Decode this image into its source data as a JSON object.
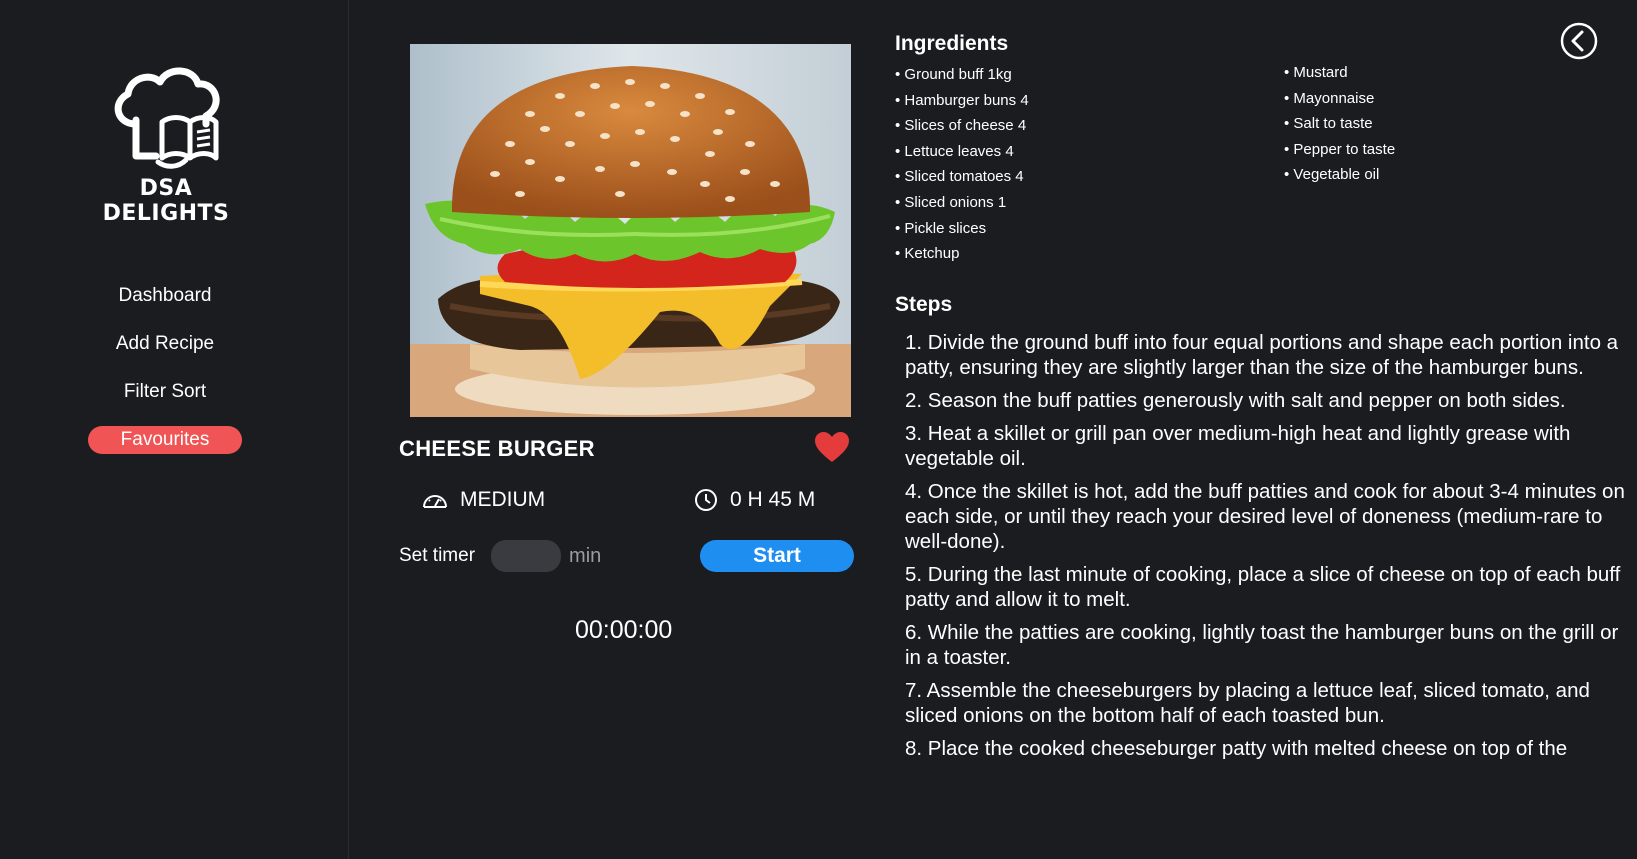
{
  "brand": {
    "name": "DSA DELIGHTS"
  },
  "nav": [
    {
      "label": "Dashboard",
      "active": false
    },
    {
      "label": "Add Recipe",
      "active": false
    },
    {
      "label": "Filter Sort",
      "active": false
    },
    {
      "label": "Favourites",
      "active": true
    }
  ],
  "recipe": {
    "title": "CHEESE BURGER",
    "difficulty": "MEDIUM",
    "time": "0 H 45 M",
    "favourite": true
  },
  "timer": {
    "label": "Set timer",
    "value": "",
    "unit": "min",
    "start_label": "Start",
    "countdown": "00:00:00"
  },
  "ingredients": {
    "title": "Ingredients",
    "column1": [
      "Ground buff 1kg",
      "Hamburger buns 4",
      "Slices of cheese 4",
      "Lettuce leaves 4",
      "Sliced tomatoes 4",
      "Sliced onions 1",
      "Pickle slices",
      "Ketchup"
    ],
    "column2": [
      "Mustard",
      "Mayonnaise",
      "Salt to taste",
      "Pepper to taste",
      "Vegetable oil"
    ]
  },
  "steps": {
    "title": "Steps",
    "items": [
      "1. Divide the ground buff into four equal portions and shape each portion into a patty, ensuring they are slightly larger than the size of the hamburger buns.",
      "2. Season the buff patties generously with salt and pepper on both sides.",
      "3. Heat a skillet or grill pan over medium-high heat and lightly grease with vegetable oil.",
      "4. Once the skillet is hot, add the buff patties and cook for about 3-4 minutes on each side, or until they reach your desired level of doneness (medium-rare to well-done).",
      "5. During the last minute of cooking, place a slice of cheese on top of each buff patty and allow it to melt.",
      "6. While the patties are cooking, lightly toast the hamburger buns on the grill or in a toaster.",
      "7. Assemble the cheeseburgers by placing a lettuce leaf, sliced tomato, and sliced onions on the bottom half of each toasted bun.",
      "8. Place the cooked cheeseburger patty with melted cheese on top of the"
    ]
  },
  "colors": {
    "background": "#1b1c20",
    "accent_red": "#f05454",
    "start_blue": "#1f8ef1",
    "heart": "#e43c3c"
  }
}
